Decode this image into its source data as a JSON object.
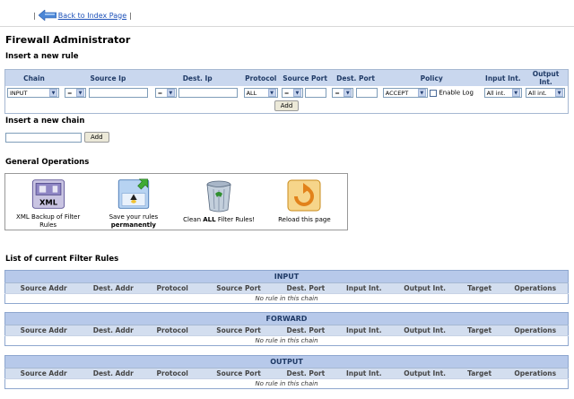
{
  "nav": {
    "back_link": "Back to Index Page",
    "pipe_left": "|",
    "pipe_right": "|"
  },
  "page_title": "Firewall Administrator",
  "insert_rule": {
    "title": "Insert a new rule",
    "columns": [
      "Chain",
      "Source Ip",
      "Dest. Ip",
      "Protocol",
      "Source Port",
      "Dest. Port",
      "Policy",
      "Input Int.",
      "Output Int."
    ],
    "chain_value": "INPUT",
    "source_op": "=",
    "dest_op": "=",
    "protocol_value": "ALL",
    "sport_op": "=",
    "dport_op": "=",
    "policy_value": "ACCEPT",
    "enable_log_label": "Enable Log",
    "input_int_value": "All int.",
    "output_int_value": "All int.",
    "add_label": "Add"
  },
  "insert_chain": {
    "title": "Insert a new chain",
    "add_label": "Add"
  },
  "general_ops": {
    "title": "General Operations",
    "xml_icon_text": "XML",
    "items": [
      {
        "label_1": "XML Backup of Filter",
        "label_2": "Rules",
        "bold": ""
      },
      {
        "label_1": "Save your rules",
        "label_2": "",
        "bold": "permanently"
      },
      {
        "label_pre": "Clean ",
        "bold": "ALL",
        "label_post": " Filter Rules!"
      },
      {
        "label_1": "Reload this page"
      }
    ]
  },
  "filter_rules": {
    "title": "List of current Filter Rules",
    "columns": [
      "Source Addr",
      "Dest. Addr",
      "Protocol",
      "Source Port",
      "Dest. Port",
      "Input Int.",
      "Output Int.",
      "Target",
      "Operations"
    ],
    "chains": [
      {
        "name": "INPUT",
        "empty_text": "No rule in this chain"
      },
      {
        "name": "FORWARD",
        "empty_text": "No rule in this chain"
      },
      {
        "name": "OUTPUT",
        "empty_text": "No rule in this chain"
      }
    ]
  }
}
